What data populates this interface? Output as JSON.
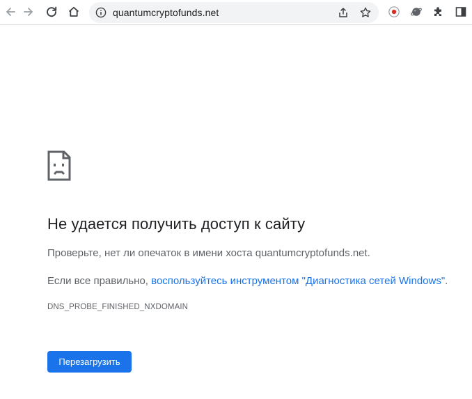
{
  "browser": {
    "url": "quantumcryptofunds.net",
    "icons": {
      "back": "arrow-left-icon",
      "forward": "arrow-right-icon",
      "reload": "reload-icon",
      "home": "home-icon",
      "site_info": "info-icon",
      "share": "share-icon",
      "bookmark": "star-icon",
      "extension_record": "record-icon",
      "extension_planet": "planet-icon",
      "extensions": "puzzle-icon",
      "side_panel": "side-panel-icon"
    }
  },
  "error_page": {
    "icon": "sad-page-icon",
    "title": "Не удается получить доступ к сайту",
    "check_text": "Проверьте, нет ли опечаток в имени хоста quantumcryptofunds.net.",
    "if_ok_prefix": "Если все правильно, ",
    "diagnostics_link": "воспользуйтесь инструментом \"Диагностика сетей Windows\"",
    "if_ok_suffix": ".",
    "error_code": "DNS_PROBE_FINISHED_NXDOMAIN",
    "reload_button": "Перезагрузить"
  },
  "colors": {
    "accent": "#1a73e8",
    "text_primary": "#202124",
    "text_secondary": "#5f6368",
    "omnibox_bg": "#f1f3f4",
    "record_red": "#d93025"
  }
}
